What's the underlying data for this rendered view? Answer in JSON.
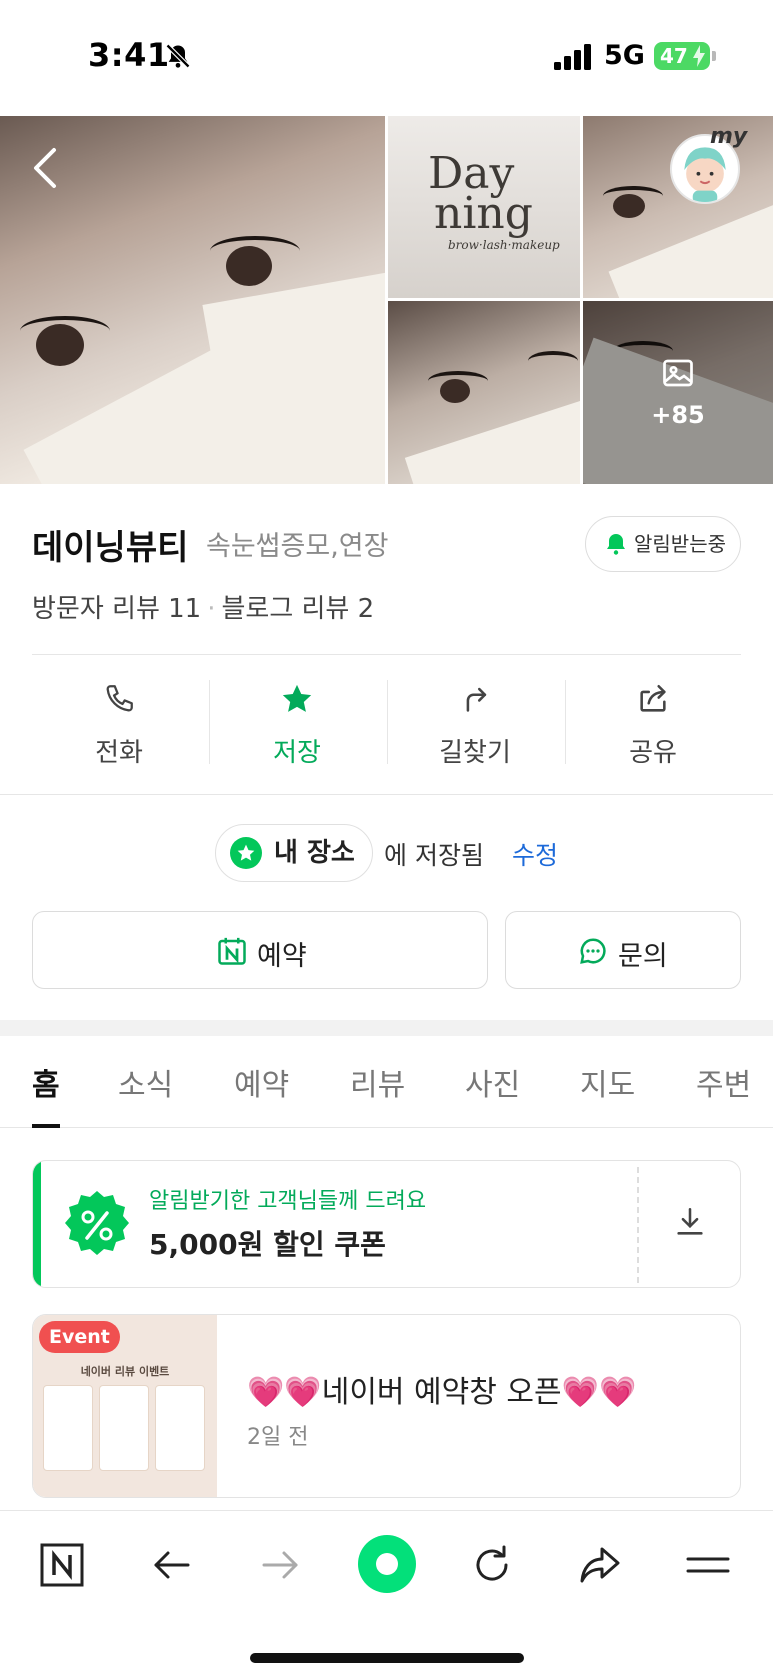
{
  "status_bar": {
    "time": "3:41",
    "network": "5G",
    "battery": "47"
  },
  "gallery": {
    "brand_top": "Day",
    "brand_bottom": "ning",
    "brand_tagline": "brow·lash·makeup",
    "my_label": "my",
    "more_count": "+85"
  },
  "place": {
    "name": "데이닝뷰티",
    "category": "속눈썹증모,연장",
    "alarm_button": "알림받는중",
    "visitor_reviews": "방문자 리뷰 11",
    "blog_reviews": "블로그 리뷰 2"
  },
  "actions": [
    {
      "label": "전화"
    },
    {
      "label": "저장"
    },
    {
      "label": "길찾기"
    },
    {
      "label": "공유"
    }
  ],
  "saved": {
    "chip": "내 장소",
    "text": "에 저장됨",
    "edit": "수정"
  },
  "buttons": {
    "reserve": "예약",
    "inquiry": "문의"
  },
  "tabs": [
    "홈",
    "소식",
    "예약",
    "리뷰",
    "사진",
    "지도",
    "주변"
  ],
  "coupon": {
    "subtitle": "알림받기한 고객님들께 드려요",
    "title": "5,000원 할인 쿠폰"
  },
  "event": {
    "tag": "Event",
    "poster_title": "네이버 리뷰 이벤트",
    "headline": "네이버 예약창 오픈",
    "hearts_left": "💗💗",
    "hearts_right": "💗💗",
    "ago": "2일 전"
  },
  "colors": {
    "accent": "#03c75a",
    "link": "#1d6ad9",
    "event_tag": "#f05050"
  }
}
